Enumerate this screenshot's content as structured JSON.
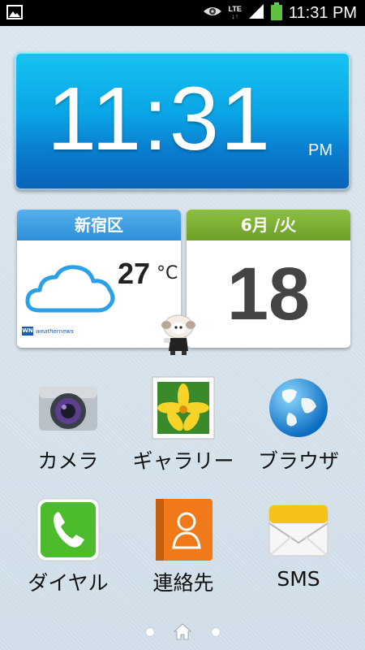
{
  "status_bar": {
    "time": "11:31 PM",
    "network": "LTE",
    "icons": [
      "gallery-notification-icon",
      "eye-icon",
      "lte-icon",
      "signal-icon",
      "battery-icon"
    ]
  },
  "clock": {
    "time": "11:31",
    "ampm": "PM"
  },
  "weather": {
    "location": "新宿区",
    "temperature": "27",
    "unit": "°C",
    "provider": "weathernews"
  },
  "calendar": {
    "month_weekday": "6月 /火",
    "day": "18"
  },
  "apps": [
    {
      "label": "カメラ",
      "icon": "camera-icon"
    },
    {
      "label": "ギャラリー",
      "icon": "gallery-icon"
    },
    {
      "label": "ブラウザ",
      "icon": "browser-globe-icon"
    },
    {
      "label": "ダイヤル",
      "icon": "phone-icon"
    },
    {
      "label": "連絡先",
      "icon": "contacts-icon"
    },
    {
      "label": "SMS",
      "icon": "sms-icon"
    }
  ],
  "navigation": {
    "pages": 3,
    "current": 2
  },
  "colors": {
    "clock_blue": "#0aa5e6",
    "weather_blue": "#2d8fd8",
    "calendar_green": "#6ea02a"
  }
}
